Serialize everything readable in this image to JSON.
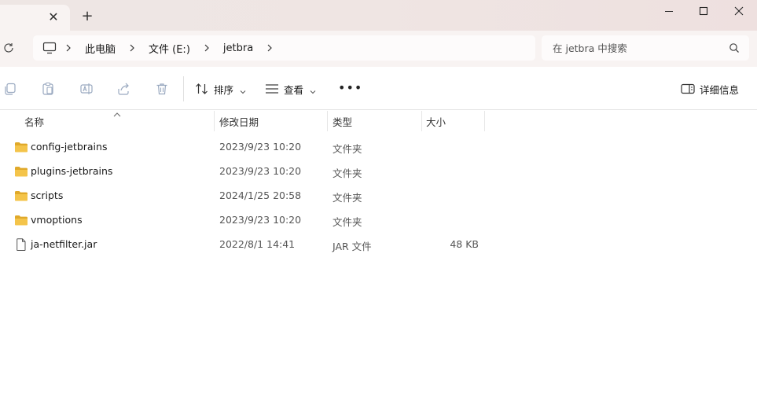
{
  "tab": {
    "close_label": "✕"
  },
  "new_tab_label": "+",
  "breadcrumb": {
    "items": [
      "此电脑",
      "文件 (E:)",
      "jetbra"
    ]
  },
  "search": {
    "placeholder": "在 jetbra 中搜索"
  },
  "toolbar": {
    "sort_label": "排序",
    "view_label": "查看",
    "more_label": "•••",
    "details_label": "详细信息"
  },
  "columns": {
    "name": "名称",
    "modified": "修改日期",
    "type": "类型",
    "size": "大小"
  },
  "files": [
    {
      "name": "config-jetbrains",
      "modified": "2023/9/23 10:20",
      "type": "文件夹",
      "size": "",
      "kind": "folder"
    },
    {
      "name": "plugins-jetbrains",
      "modified": "2023/9/23 10:20",
      "type": "文件夹",
      "size": "",
      "kind": "folder"
    },
    {
      "name": "scripts",
      "modified": "2024/1/25 20:58",
      "type": "文件夹",
      "size": "",
      "kind": "folder"
    },
    {
      "name": "vmoptions",
      "modified": "2023/9/23 10:20",
      "type": "文件夹",
      "size": "",
      "kind": "folder"
    },
    {
      "name": "ja-netfilter.jar",
      "modified": "2022/8/1 14:41",
      "type": "JAR 文件",
      "size": "48 KB",
      "kind": "file"
    }
  ],
  "colors": {
    "folder_yellow": "#f4c44a",
    "folder_dark": "#e0a92a",
    "disabled_icon": "#9aa9c0"
  }
}
